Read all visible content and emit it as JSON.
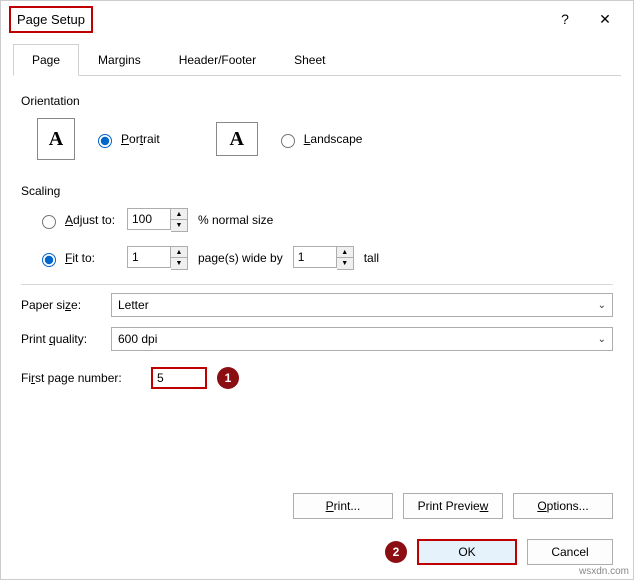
{
  "dialog": {
    "title": "Page Setup",
    "help_symbol": "?",
    "close_symbol": "✕",
    "watermark": "wsxdn.com"
  },
  "tabs": {
    "page": "Page",
    "margins": "Margins",
    "header_footer": "Header/Footer",
    "sheet": "Sheet"
  },
  "orientation": {
    "title": "Orientation",
    "portrait": "Portrait",
    "landscape": "Landscape",
    "icon_letter": "A"
  },
  "scaling": {
    "title": "Scaling",
    "adjust_to": "Adjust to:",
    "adjust_value": "100",
    "adjust_suffix": "% normal size",
    "fit_to": "Fit to:",
    "fit_wide_value": "1",
    "fit_wide_suffix": "page(s) wide by",
    "fit_tall_value": "1",
    "fit_tall_suffix": "tall"
  },
  "paper_size": {
    "label": "Paper size:",
    "value": "Letter"
  },
  "print_quality": {
    "label": "Print quality:",
    "value": "600 dpi"
  },
  "first_page": {
    "label": "First page number:",
    "value": "5"
  },
  "buttons": {
    "print": "Print...",
    "print_preview": "Print Preview",
    "options": "Options...",
    "ok": "OK",
    "cancel": "Cancel"
  },
  "badges": {
    "one": "1",
    "two": "2"
  }
}
